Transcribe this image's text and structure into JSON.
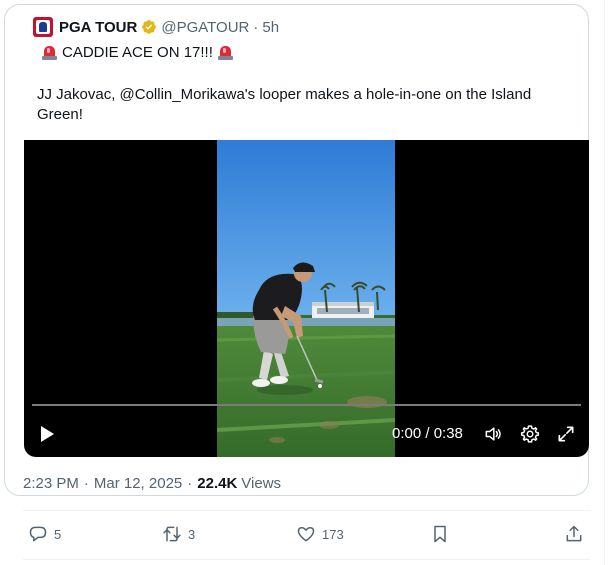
{
  "tweet": {
    "author_name": "PGA TOUR",
    "handle": "@PGATOUR",
    "separator": "·",
    "time_ago": "5h",
    "line1": "CADDIE ACE ON 17!!!",
    "line2": "JJ Jakovac, @Collin_Morikawa's looper makes a hole-in-one on the Island Green!"
  },
  "video": {
    "time": "0:00 / 0:38",
    "progress": 0
  },
  "meta": {
    "time": "2:23 PM",
    "date": "Mar 12, 2025",
    "views_count": "22.4K",
    "views_label": "Views",
    "dot": "·"
  },
  "actions": {
    "replies": "5",
    "reposts": "3",
    "likes": "173"
  },
  "colors": {
    "verified": "#e2b719",
    "text_secondary": "#536471",
    "border": "#cfd9de"
  },
  "icons": [
    "pga-tour-logo",
    "verified-badge-icon",
    "siren-icon",
    "play-icon",
    "volume-icon",
    "gear-icon",
    "fullscreen-icon",
    "reply-icon",
    "repost-icon",
    "like-icon",
    "bookmark-icon",
    "share-icon"
  ]
}
